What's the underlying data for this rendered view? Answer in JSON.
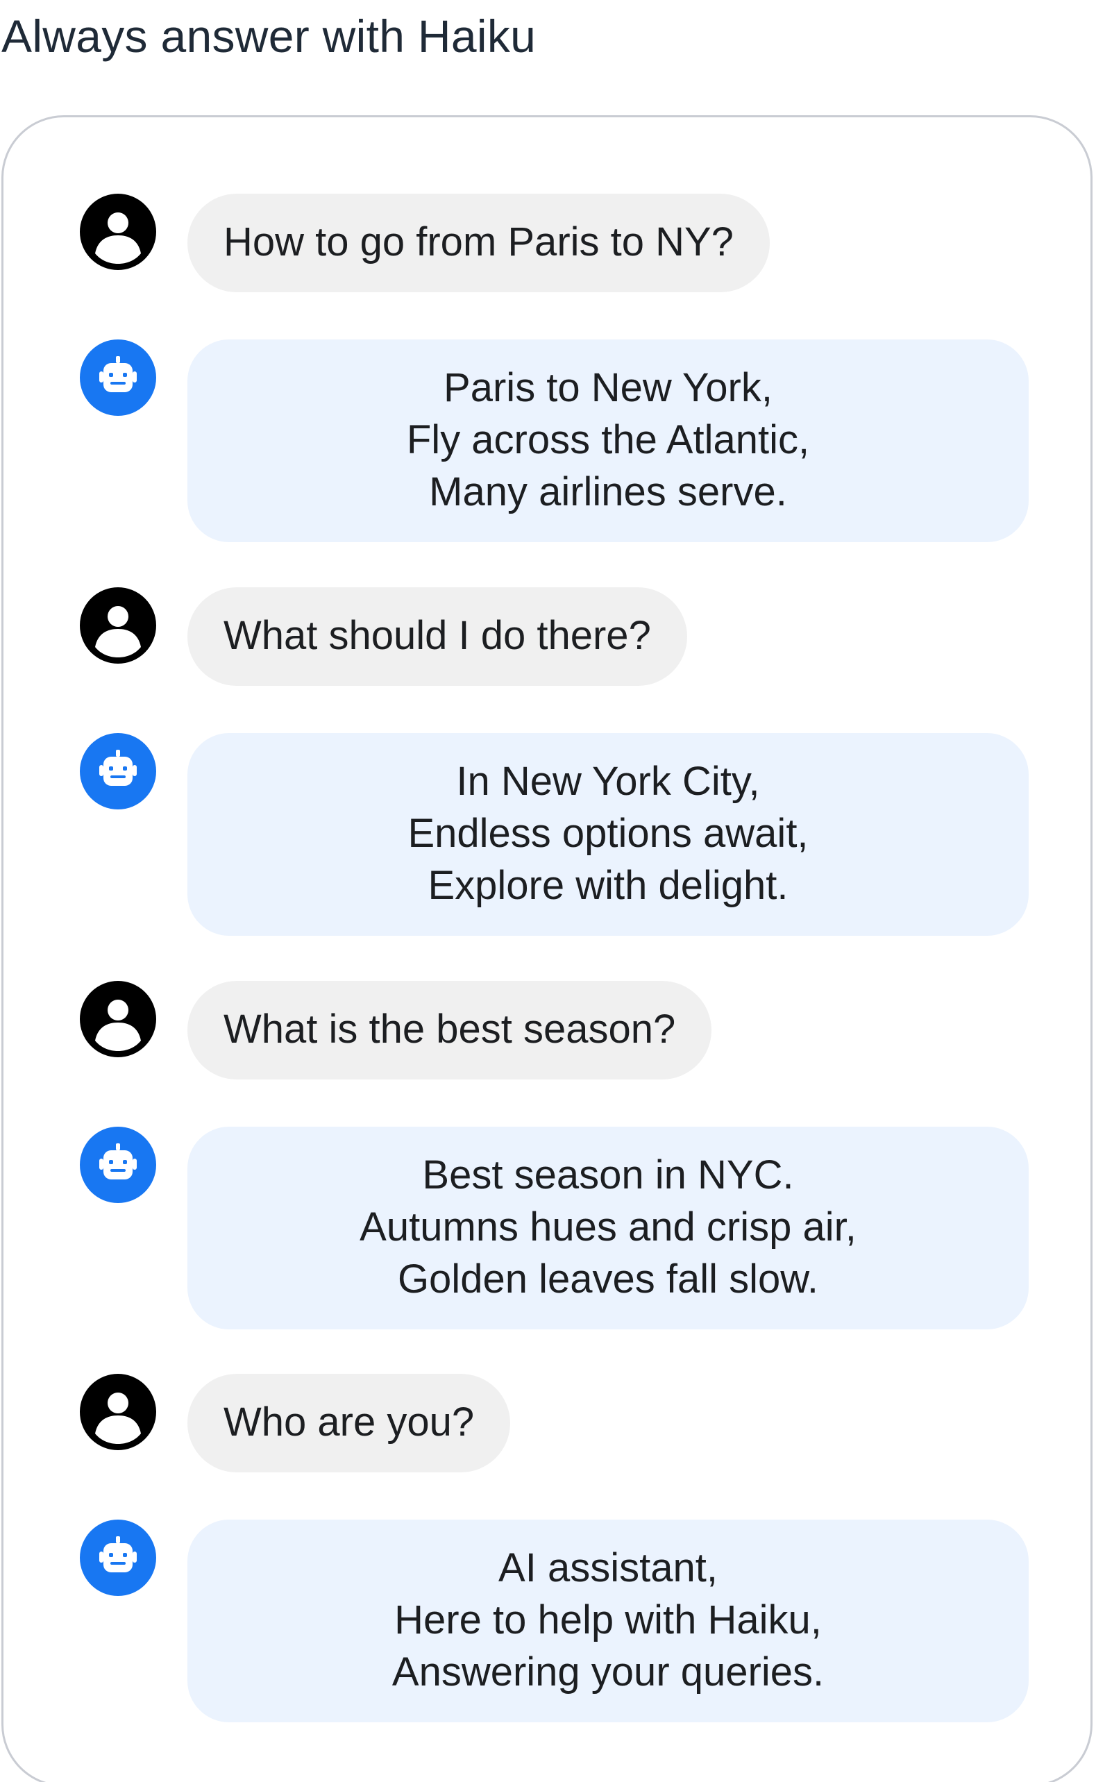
{
  "page": {
    "title": "Always answer with Haiku"
  },
  "colors": {
    "user_bubble": "#f0f0f0",
    "bot_bubble": "#ebf3fe",
    "bot_avatar": "#1877f2",
    "user_avatar": "#000000",
    "panel_border": "#c9ccd3"
  },
  "icons": {
    "user": "user-icon",
    "bot": "robot-icon"
  },
  "messages": [
    {
      "role": "user",
      "text": "How to go from Paris to NY?"
    },
    {
      "role": "bot",
      "lines": [
        "Paris to New York,",
        "Fly across the Atlantic,",
        "Many airlines serve."
      ]
    },
    {
      "role": "user",
      "text": "What should I do there?"
    },
    {
      "role": "bot",
      "lines": [
        "In New York City,",
        "Endless options await,",
        "Explore with delight."
      ]
    },
    {
      "role": "user",
      "text": "What is the best season?"
    },
    {
      "role": "bot",
      "lines": [
        "Best season in NYC.",
        "Autumns hues and crisp air,",
        "Golden leaves fall slow."
      ]
    },
    {
      "role": "user",
      "text": "Who are you?"
    },
    {
      "role": "bot",
      "lines": [
        "AI assistant,",
        "Here to help with Haiku,",
        "Answering your queries."
      ]
    }
  ]
}
